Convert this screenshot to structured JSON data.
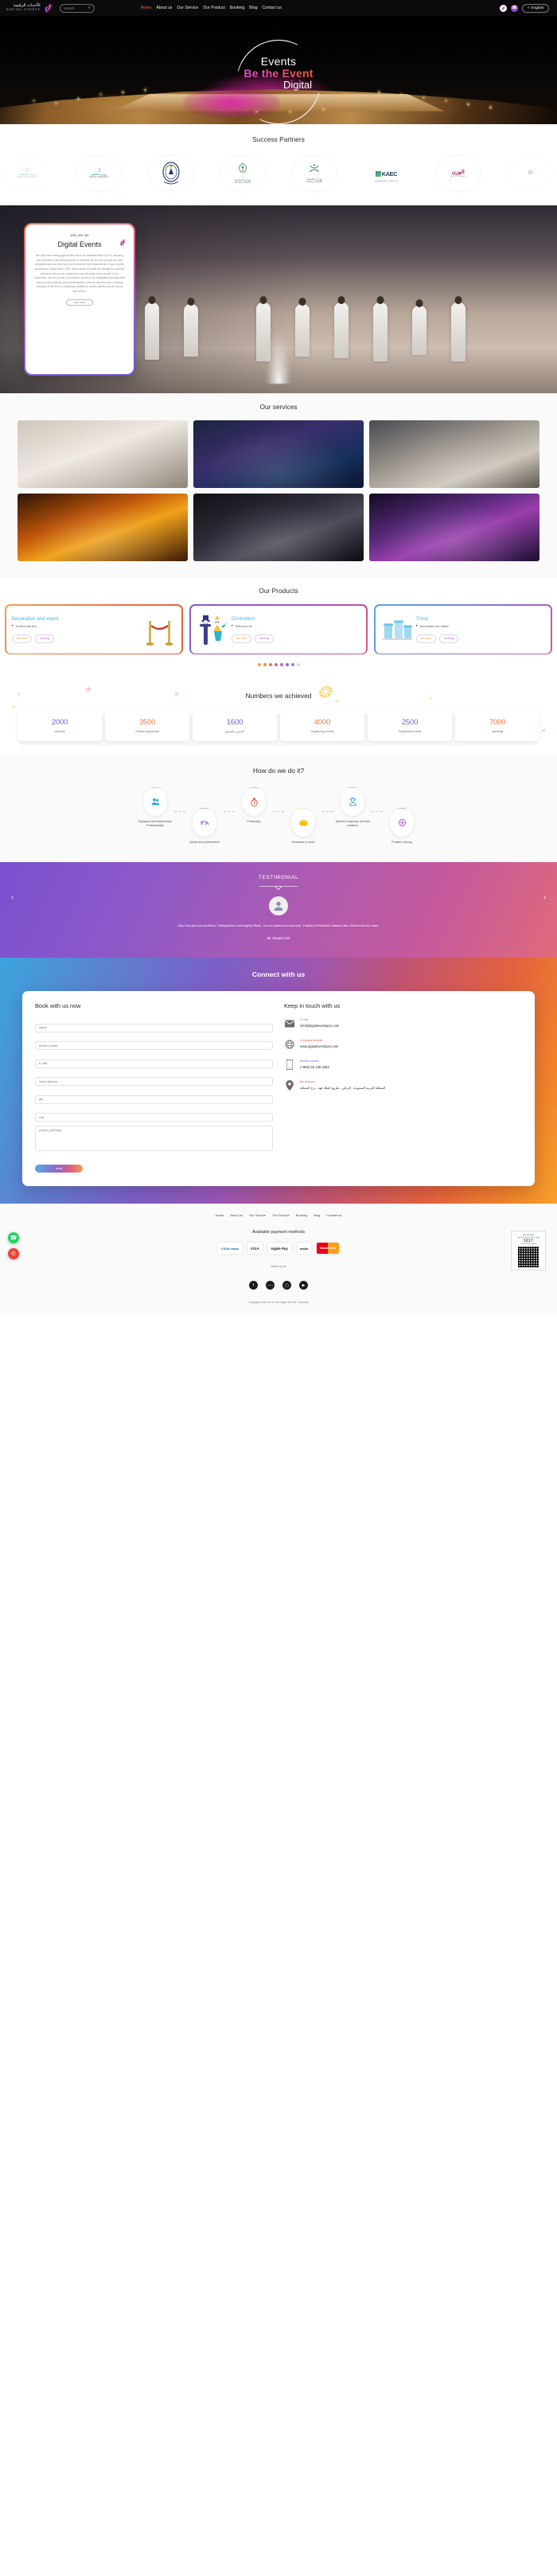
{
  "header": {
    "brand_ar": "الأحداث الرقمية",
    "brand_en": "DIGITAL EVENTS",
    "search_placeholder": "Search",
    "search_icon": "search-icon",
    "nav": [
      {
        "label": "Home",
        "active": true
      },
      {
        "label": "About us",
        "active": false
      },
      {
        "label": "Our Service",
        "active": false
      },
      {
        "label": "Our Product",
        "active": false
      },
      {
        "label": "Booking",
        "active": false
      },
      {
        "label": "Blog",
        "active": false
      },
      {
        "label": "Contact us",
        "active": false
      }
    ],
    "lang_label": "English",
    "lang_caret": "chevron-down-icon",
    "whatsapp_icon": "whatsapp-icon",
    "logo_icon": "logo-icon"
  },
  "hero": {
    "line1": "Events",
    "line2": "Be the Event",
    "line3": "Digital"
  },
  "partners": {
    "title": "Success Partners",
    "items": [
      {
        "name": "ministry-of-education",
        "ar": "وزارة التعليم",
        "en": "Ministry of Education"
      },
      {
        "name": "police-emblem",
        "ar": "",
        "en": ""
      },
      {
        "name": "ministry-of-sports",
        "ar": "وزارة الرياضة",
        "en": "Ministry of Sports"
      },
      {
        "name": "ministry-of-health",
        "ar": "وزارة الصحة",
        "en": "Ministry of Health"
      },
      {
        "name": "kaec",
        "ar": "مدينة الملك عبدالله الاقتصادية",
        "en": "KAEC"
      },
      {
        "name": "al-nokhba",
        "ar": "الوزن",
        "en": "AL NOKHBA"
      }
    ]
  },
  "about": {
    "kicker": "who are we",
    "heading": "Digital Events",
    "body": "We have been racing against time since our establishment in 2013, stepping with confidence and development, to embrace the sky and provide the best integrated services that meet your needs and the requirements of your events, according to Saudi Vision 2030, which seeks to invest the strengths to achieve ambitions.We put our experience over the years at the service of our customers, and we provide an exclusive service in an integrated and organized manner with creativity and professionalism, until we have become a leading company in the field of organizing exhibitions, events, parties and all events and events.",
    "button": "see more"
  },
  "services": {
    "title": "Our services",
    "images": [
      {
        "name": "service-image-ceremony"
      },
      {
        "name": "service-image-concert"
      },
      {
        "name": "service-image-hall"
      },
      {
        "name": "service-image-fire-show"
      },
      {
        "name": "service-image-camera-crew"
      },
      {
        "name": "service-image-stage-lighting"
      }
    ]
  },
  "products": {
    "title": "Our Products",
    "cards": [
      {
        "title": "Decoration and event",
        "items": [
          "Golden barriers"
        ],
        "more_label": "see more",
        "book_label": "Booking",
        "art": "golden-barrier-icon"
      },
      {
        "title": "Controllers",
        "items": [
          "Welcome air"
        ],
        "more_label": "see more",
        "book_label": "Booking",
        "art": "air-dancer-icon"
      },
      {
        "title": "Trimo",
        "items": [
          "Illuminated bar tables"
        ],
        "more_label": "see more",
        "book_label": "Booking",
        "art": "bar-table-icon"
      }
    ],
    "dots": [
      "#f0a04a",
      "#ef8c4a",
      "#e9743f",
      "#e2628c",
      "#b46ad0",
      "#8a6ad8",
      "#5f9fd9",
      "#d9d9d9"
    ]
  },
  "numbers": {
    "title": "Numbers we achieved",
    "stats": [
      {
        "value": "2000",
        "label": "concerts",
        "color": "#7b5fd6"
      },
      {
        "value": "3500",
        "label": "Theater equipment",
        "color": "#ef7a3f"
      },
      {
        "value": "1600",
        "label": "التصوير والتوثيق",
        "color": "#6f5fd6"
      },
      {
        "value": "4000",
        "label": "Organizing events",
        "color": "#ef7a3f"
      },
      {
        "value": "2500",
        "label": "Organizing events",
        "color": "#7b5fd6"
      },
      {
        "value": "7000",
        "label": "openings",
        "color": "#ef7a3f"
      }
    ]
  },
  "how": {
    "title": "How do we do it?",
    "steps": [
      {
        "label": "Equipped and trained team Professionally",
        "icon": "team-icon",
        "color": "#2aa3e0",
        "position": "up"
      },
      {
        "label": "Speed and achievement",
        "icon": "speedometer-icon",
        "color": "#9b51c9",
        "position": "down"
      },
      {
        "label": "Punctuality",
        "icon": "stopwatch-icon",
        "color": "#e03c21",
        "position": "up"
      },
      {
        "label": "Dedication to work",
        "icon": "briefcase-icon",
        "color": "#f2c20a",
        "position": "down"
      },
      {
        "label": "Speed of response and find solutions",
        "icon": "headset-agent-icon",
        "color": "#2aa3e0",
        "position": "up"
      },
      {
        "label": "Problem Solving",
        "icon": "puzzle-icon",
        "color": "#9b51c9",
        "position": "down"
      }
    ]
  },
  "testimonial": {
    "heading": "TESTIMONIAL",
    "avatar": "user-avatar",
    "quote": "May God give you wellness, Distinguished and mighty efforts. You are partners in success. Thanks to Professor Hashem Abu Ahmed and the team.",
    "author": "Mr. Moaed Asiri",
    "prev_icon": "chevron-left-icon",
    "next_icon": "chevron-right-icon"
  },
  "connect": {
    "heading": "Connect with us",
    "form": {
      "title": "Book with us now",
      "fields": [
        {
          "name": "name-field",
          "placeholder": "Name",
          "type": "text"
        },
        {
          "name": "mobile-field",
          "placeholder": "Mobile number",
          "type": "text"
        },
        {
          "name": "email-field",
          "placeholder": "E-mail",
          "type": "text"
        },
        {
          "name": "service-select",
          "placeholder": "Select Service",
          "type": "select"
        },
        {
          "name": "gift-field",
          "placeholder": "gift",
          "type": "text"
        },
        {
          "name": "city-field",
          "placeholder": "City",
          "type": "text"
        },
        {
          "name": "project-summary-field",
          "placeholder": "project_summary",
          "type": "textarea"
        }
      ],
      "submit": "send"
    },
    "contact": {
      "title": "Keep in touch with us",
      "items": [
        {
          "icon": "envelope-icon",
          "label": "E-mail",
          "label_color": "#4aa8e0",
          "value": "info@digitaleventspro.com"
        },
        {
          "icon": "globe-icon",
          "label": "Company website",
          "label_color": "#e8604a",
          "value": "www.digitaleventspro.com"
        },
        {
          "icon": "phone-icon",
          "label": "Mobile number",
          "label_color": "#7b5fd6",
          "value": "(+966) 56 138 0363"
        },
        {
          "icon": "location-pin-icon",
          "label": "the address",
          "label_color": "#e8604a",
          "value": "المملكة العربية السعودية - الرياض - طريق الملك فهد - برج المملكة"
        }
      ]
    }
  },
  "footer": {
    "nav": [
      "Home",
      "About us",
      "Our Service",
      "Our Product",
      "Booking",
      "Blog",
      "Contact us"
    ],
    "payments_title": "Available payment methods",
    "payments": [
      {
        "name": "sadad-logo",
        "label": "CS3d mada"
      },
      {
        "name": "visa-logo",
        "label": "VISA"
      },
      {
        "name": "apple-pay-logo",
        "label": "Apple Pay"
      },
      {
        "name": "mada-logo",
        "label": "mada"
      },
      {
        "name": "mastercard-logo",
        "label": "MasterCard"
      }
    ],
    "certificate": {
      "top_label": "Tax Number",
      "heading": "الهيئة العامة للزكاة والدخل",
      "number": "1017",
      "sub": "Commercial register"
    },
    "follow_label": "follow us on",
    "socials": [
      "facebook-icon",
      "twitter-icon",
      "instagram-icon",
      "youtube-icon"
    ],
    "copyright": "Copyright reserved to the Digital Events Company",
    "float_buttons": [
      {
        "name": "whatsapp-float-button",
        "icon": "whatsapp-icon",
        "color": "#25d366"
      },
      {
        "name": "phone-float-button",
        "icon": "phone-icon",
        "color": "#ea4335"
      }
    ]
  }
}
